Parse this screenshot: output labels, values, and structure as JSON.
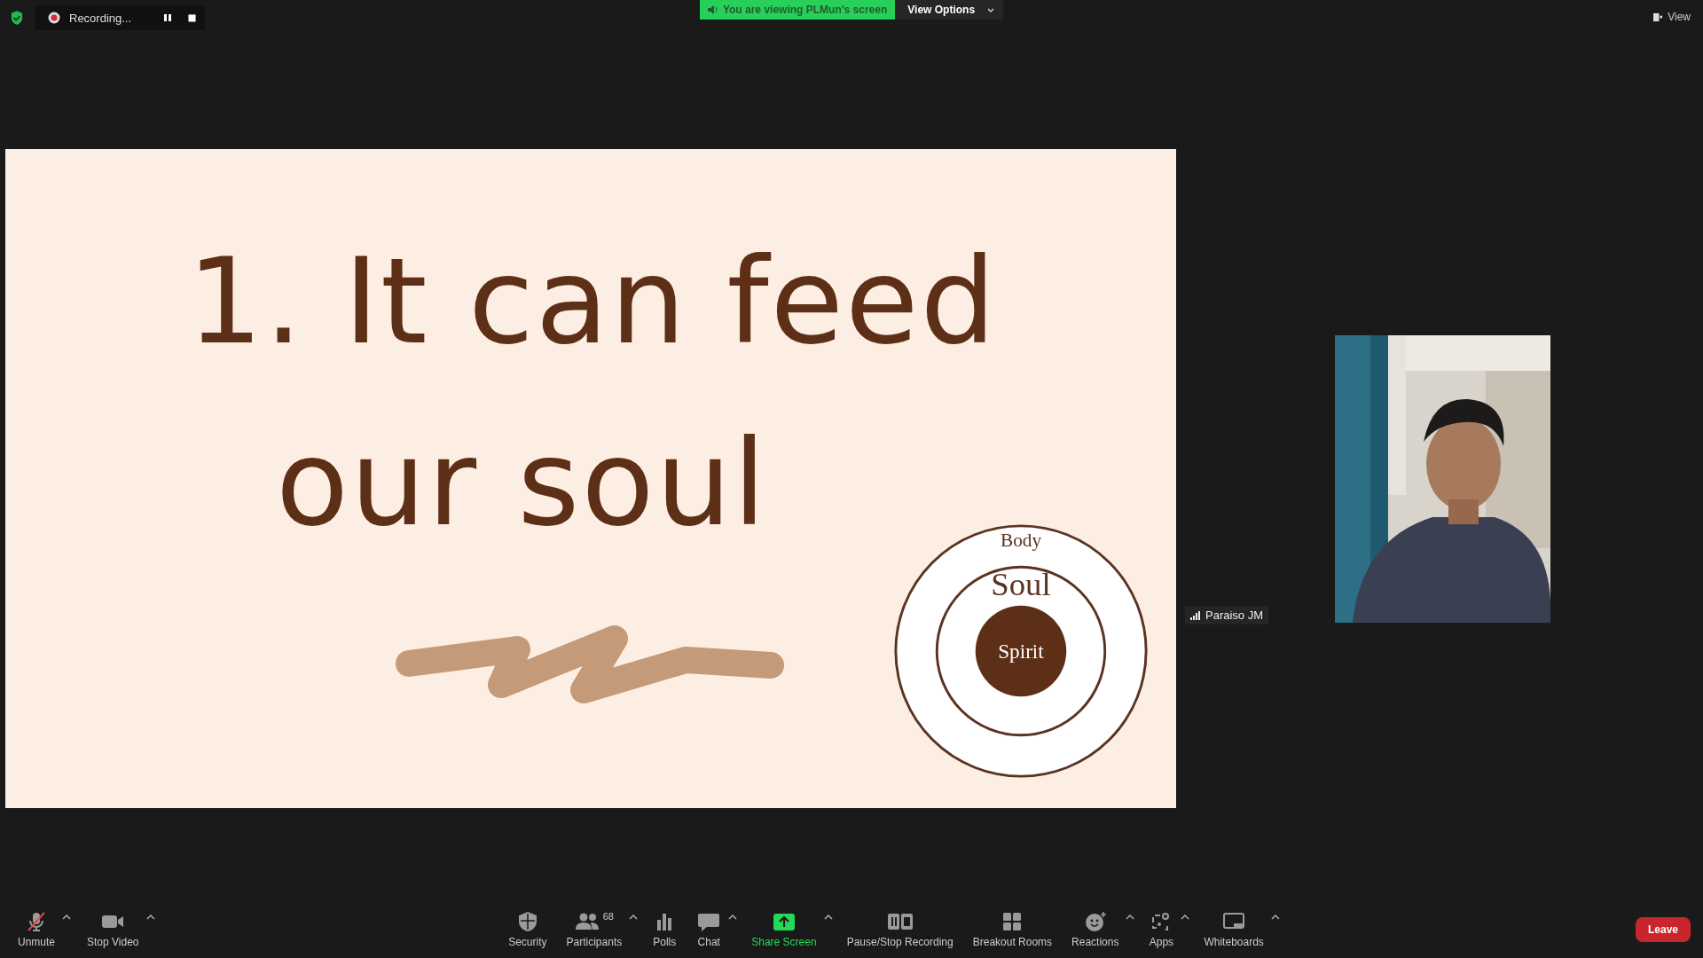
{
  "top_bar": {
    "recording": {
      "status": "Recording..."
    },
    "share_banner": {
      "text": "You are viewing PLMun's screen"
    },
    "view_options": {
      "label": "View Options"
    },
    "view_button": {
      "label": "View"
    }
  },
  "slide": {
    "title_lines": [
      "1. It can feed",
      "our soul"
    ],
    "diagram_labels": [
      "Body",
      "Soul",
      "Spirit"
    ]
  },
  "participant": {
    "name": "Paraiso JM"
  },
  "toolbar": {
    "left": [
      {
        "label": "Unmute",
        "caret": true,
        "active": false
      },
      {
        "label": "Stop Video",
        "caret": true,
        "active": false
      }
    ],
    "center": [
      {
        "label": "Security",
        "caret": false,
        "active": false
      },
      {
        "label": "Participants",
        "count": "68",
        "caret": true,
        "active": false
      },
      {
        "label": "Polls",
        "caret": false,
        "active": false
      },
      {
        "label": "Chat",
        "caret": true,
        "active": false
      },
      {
        "label": "Share Screen",
        "caret": true,
        "active": true
      },
      {
        "label": "Pause/Stop Recording",
        "caret": false,
        "active": false
      },
      {
        "label": "Breakout Rooms",
        "caret": false,
        "active": false
      },
      {
        "label": "Reactions",
        "caret": true,
        "active": false
      },
      {
        "label": "Apps",
        "caret": true,
        "active": false
      },
      {
        "label": "Whiteboards",
        "caret": true,
        "active": false
      }
    ],
    "leave": {
      "label": "Leave"
    }
  }
}
